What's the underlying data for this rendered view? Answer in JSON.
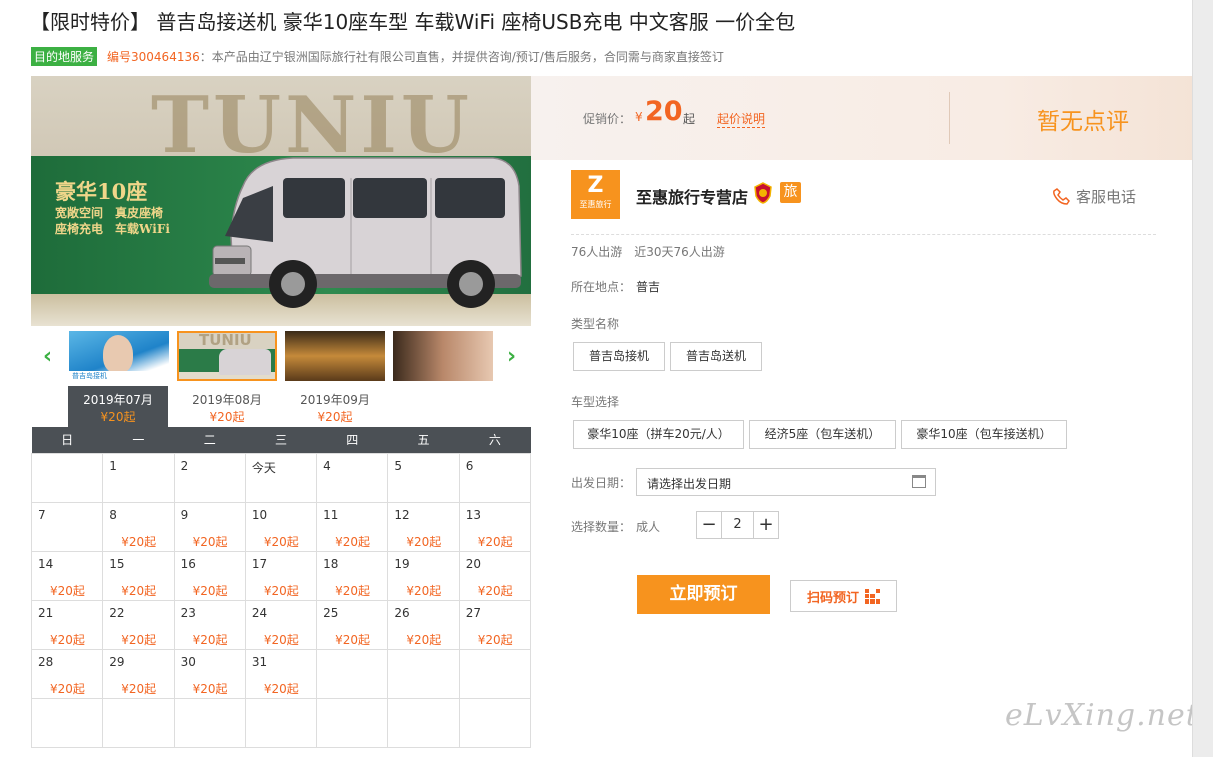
{
  "title": "【限时特价】 普吉岛接送机 豪华10座车型 车载WiFi 座椅USB充电 中文客服 一价全包",
  "sub": {
    "badge": "目的地服务",
    "code": "编号300464136",
    "text": "：本产品由辽宁银洲国际旅行社有限公司直售，并提供咨询/预订/售后服务，合同需与商家直接签订"
  },
  "hero": {
    "brand_word": "TUNIU",
    "headline": "豪华10座",
    "line1": "宽敞空间　真皮座椅",
    "line2": "座椅充电　车载WiFi"
  },
  "price": {
    "label": "促销价：",
    "currency": "¥",
    "amount": "20",
    "suffix": "起",
    "explain_link": "起价说明",
    "review": "暂无点评"
  },
  "shop": {
    "logo_letter": "Z",
    "logo_text": "至惠旅行",
    "name": "至惠旅行专营店",
    "badge_travel": "旅",
    "service": "客服电话",
    "stats": "76人出游　近30天76人出游"
  },
  "location": {
    "label": "所在地点：",
    "value": "普吉"
  },
  "type": {
    "label": "类型名称",
    "options": [
      "普吉岛接机",
      "普吉岛送机"
    ]
  },
  "car": {
    "label": "车型选择",
    "options": [
      "豪华10座（拼车20元/人）",
      "经济5座（包车送机）",
      "豪华10座（包车接送机）"
    ]
  },
  "date": {
    "label": "出发日期：",
    "placeholder": "请选择出发日期"
  },
  "qty": {
    "label": "选择数量：",
    "type": "成人",
    "minus": "−",
    "value": "2",
    "plus": "+"
  },
  "actions": {
    "book": "立即预订",
    "scan": "扫码预订"
  },
  "months": [
    {
      "label": "2019年07月",
      "price": "¥20起",
      "active": true
    },
    {
      "label": "2019年08月",
      "price": "¥20起",
      "active": false
    },
    {
      "label": "2019年09月",
      "price": "¥20起",
      "active": false
    }
  ],
  "weekdays": [
    "日",
    "一",
    "二",
    "三",
    "四",
    "五",
    "六"
  ],
  "calendar": [
    [
      [
        "",
        ""
      ],
      [
        "1",
        ""
      ],
      [
        "2",
        ""
      ],
      [
        "今天",
        ""
      ],
      [
        "4",
        ""
      ],
      [
        "5",
        ""
      ],
      [
        "6",
        ""
      ]
    ],
    [
      [
        "7",
        ""
      ],
      [
        "8",
        "¥20起"
      ],
      [
        "9",
        "¥20起"
      ],
      [
        "10",
        "¥20起"
      ],
      [
        "11",
        "¥20起"
      ],
      [
        "12",
        "¥20起"
      ],
      [
        "13",
        "¥20起"
      ]
    ],
    [
      [
        "14",
        "¥20起"
      ],
      [
        "15",
        "¥20起"
      ],
      [
        "16",
        "¥20起"
      ],
      [
        "17",
        "¥20起"
      ],
      [
        "18",
        "¥20起"
      ],
      [
        "19",
        "¥20起"
      ],
      [
        "20",
        "¥20起"
      ]
    ],
    [
      [
        "21",
        "¥20起"
      ],
      [
        "22",
        "¥20起"
      ],
      [
        "23",
        "¥20起"
      ],
      [
        "24",
        "¥20起"
      ],
      [
        "25",
        "¥20起"
      ],
      [
        "26",
        "¥20起"
      ],
      [
        "27",
        "¥20起"
      ]
    ],
    [
      [
        "28",
        "¥20起"
      ],
      [
        "29",
        "¥20起"
      ],
      [
        "30",
        "¥20起"
      ],
      [
        "31",
        "¥20起"
      ],
      [
        "",
        ""
      ],
      [
        "",
        ""
      ],
      [
        "",
        ""
      ]
    ],
    [
      [
        "",
        ""
      ],
      [
        "",
        ""
      ],
      [
        "",
        ""
      ],
      [
        "",
        ""
      ],
      [
        "",
        ""
      ],
      [
        "",
        ""
      ],
      [
        "",
        ""
      ]
    ]
  ],
  "nav": {
    "prev": "‹",
    "next": "›"
  },
  "thumbs": [
    {
      "caption": "普吉岛接机"
    },
    {
      "caption": "TUNIU"
    },
    {
      "caption": ""
    },
    {
      "caption": ""
    }
  ],
  "watermark": "eLvXing.net",
  "colors": {
    "accent": "#f7931e",
    "price": "#f26522",
    "badge": "#3cb043",
    "dark": "#4b5055"
  }
}
